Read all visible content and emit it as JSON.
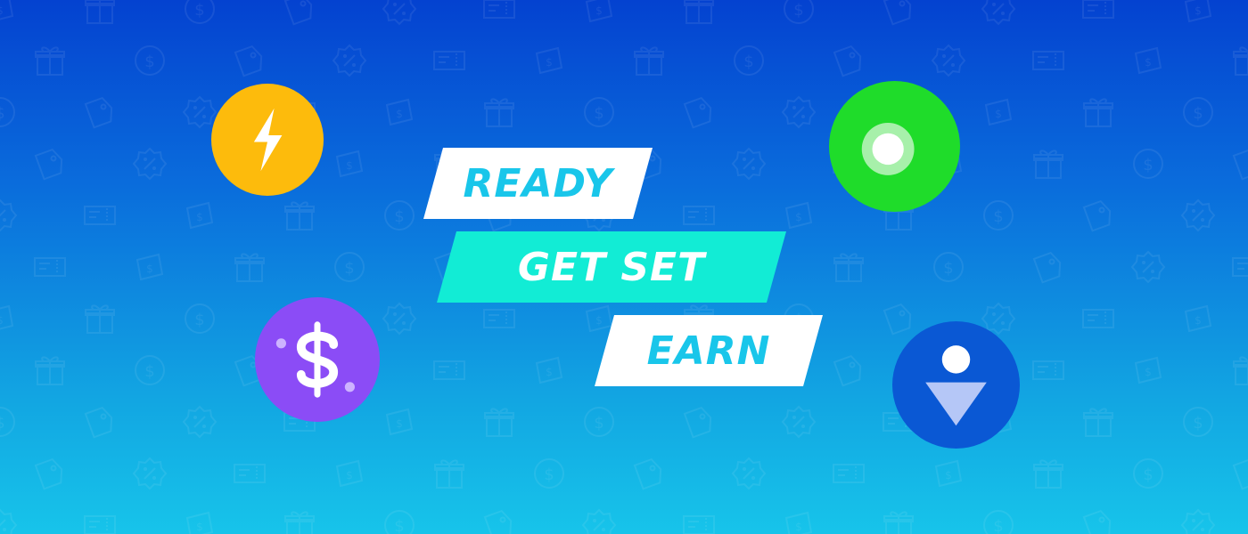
{
  "tags": {
    "ready": "READY",
    "get_set": "GET SET",
    "earn": "EARN"
  },
  "icons": {
    "bolt": "lightning-bolt-icon",
    "record": "record-icon",
    "dollar": "dollar-sign-icon",
    "person": "person-icon",
    "pattern": [
      "coupon-icon",
      "gift-icon",
      "coin-icon",
      "price-tag-icon",
      "badge-percent-icon",
      "ticket-icon"
    ]
  },
  "colors": {
    "background_top": "#0442d0",
    "background_bottom": "#17c4ea",
    "bolt_circle": "#fdbb0c",
    "record_circle": "#1fdc2a",
    "dollar_circle": "#8b4cf6",
    "person_circle": "#0a58d4",
    "get_set_tag": "#12ecd5",
    "tag_text_accent": "#19c6ea"
  }
}
